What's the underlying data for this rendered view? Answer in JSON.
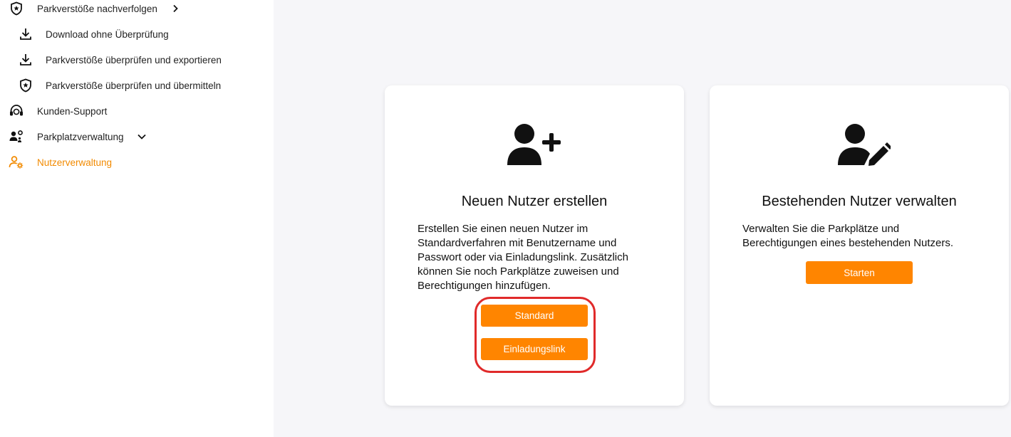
{
  "sidebar": {
    "items": [
      {
        "label": "Parkverstöße nachverfolgen",
        "icon": "shield-star-icon",
        "expand": "chevron-right-icon"
      },
      {
        "label": "Download ohne Überprüfung",
        "icon": "download-icon"
      },
      {
        "label": "Parkverstöße überprüfen und exportieren",
        "icon": "download-icon"
      },
      {
        "label": "Parkverstöße überprüfen und übermitteln",
        "icon": "shield-star-icon"
      },
      {
        "label": "Kunden-Support",
        "icon": "headset-icon"
      },
      {
        "label": "Parkplatzverwaltung",
        "icon": "users-gear-icon",
        "expand": "chevron-down-icon"
      },
      {
        "label": "Nutzerverwaltung",
        "icon": "user-gear-icon",
        "active": true
      }
    ]
  },
  "cards": {
    "create": {
      "icon": "user-plus-icon",
      "title": "Neuen Nutzer erstellen",
      "text_lines": [
        "Erstellen Sie einen neuen Nutzer im",
        "Standardverfahren mit Benutzername und",
        "Passwort oder via Einladungslink. Zusätzlich",
        "können Sie noch Parkplätze zuweisen und",
        "Berechtigungen hinzufügen."
      ],
      "btn_standard": "Standard",
      "btn_invite": "Einladungslink"
    },
    "manage": {
      "icon": "user-pen-icon",
      "title": "Bestehenden Nutzer verwalten",
      "text_lines": [
        "Verwalten Sie die Parkplätze und",
        "Berechtigungen eines bestehenden Nutzers."
      ],
      "btn_start": "Starten"
    }
  },
  "colors": {
    "accent": "#ff8500",
    "active_nav": "#f28a00",
    "highlight": "#e02a2a",
    "background": "#f6f6f9"
  }
}
